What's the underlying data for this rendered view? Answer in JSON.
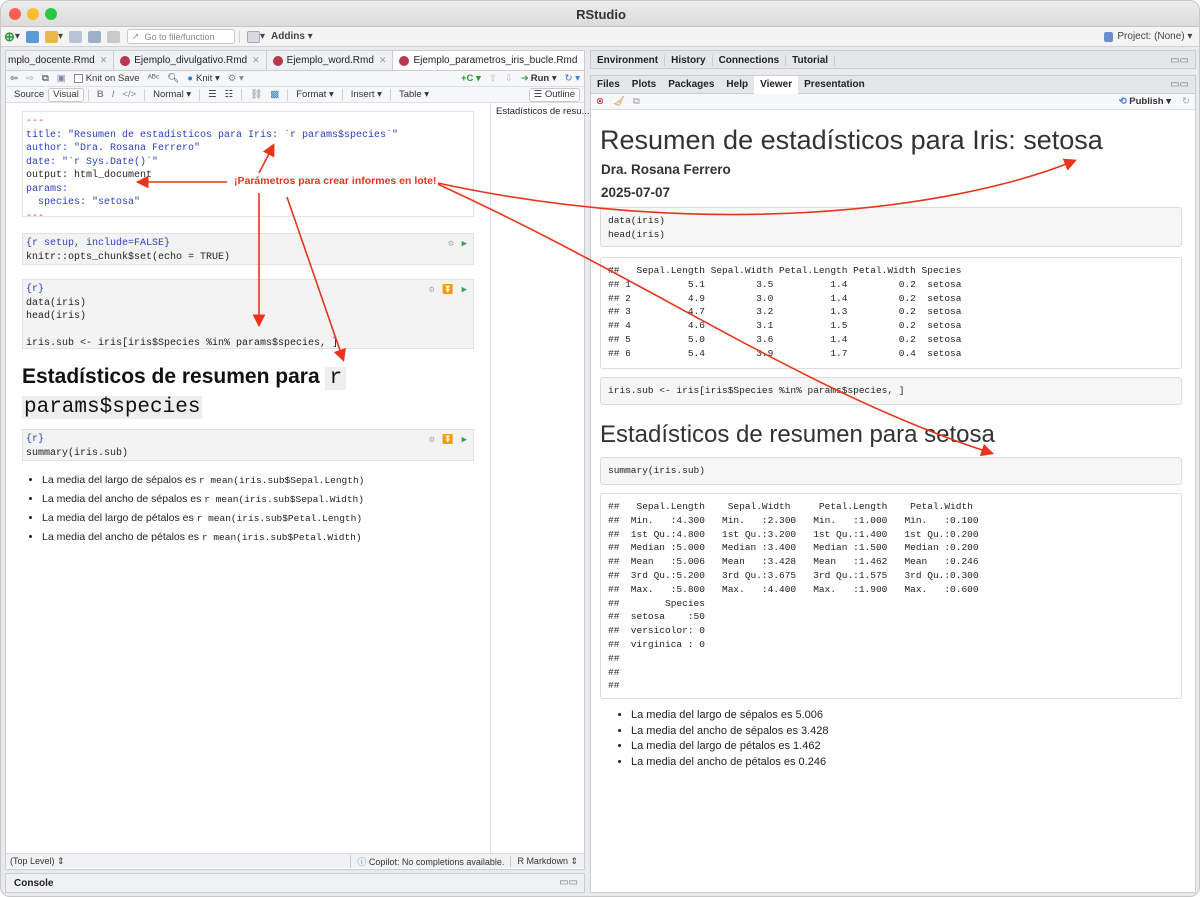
{
  "window": {
    "title": "RStudio"
  },
  "toolbar": {
    "goto_placeholder": "Go to file/function",
    "addins": "Addins",
    "project": "Project: (None)"
  },
  "editor": {
    "tabs": [
      "mplo_docente.Rmd",
      "Ejemplo_divulgativo.Rmd",
      "Ejemplo_word.Rmd",
      "Ejemplo_parametros_iris_bucle.Rmd"
    ],
    "toolbar": {
      "knit_on_save": "Knit on Save",
      "knit": "Knit",
      "run": "Run",
      "source": "Source",
      "visual": "Visual",
      "normal": "Normal",
      "format": "Format",
      "insert": "Insert",
      "table": "Table",
      "outline": "Outline"
    },
    "outline_item": "Estadísticos de resu...",
    "yaml": [
      "---",
      "title: \"Resumen de estadísticos para Iris: `r params$species`\"",
      "author: \"Dra. Rosana Ferrero\"",
      "date: \"`r Sys.Date()`\"",
      "output: html_document",
      "params:",
      "  species: \"setosa\"",
      "---"
    ],
    "chunk_setup": [
      "{r setup, include=FALSE}",
      "knitr::opts_chunk$set(echo = TRUE)"
    ],
    "chunk_data": [
      "{r}",
      "data(iris)",
      "head(iris)",
      "",
      "iris.sub <- iris[iris$Species %in% params$species, ]"
    ],
    "heading_text": "Estadísticos de resumen para",
    "heading_code1": "r",
    "heading_code2": "params$species",
    "chunk_summary": [
      "{r}",
      "summary(iris.sub)"
    ],
    "bullets": [
      {
        "text": "La media del largo de sépalos es",
        "code": "r mean(iris.sub$Sepal.Length)"
      },
      {
        "text": "La media del ancho de sépalos es",
        "code": "r mean(iris.sub$Sepal.Width)"
      },
      {
        "text": "La media del largo de pétalos es",
        "code": "r mean(iris.sub$Petal.Length)"
      },
      {
        "text": "La media del ancho de pétalos es",
        "code": "r mean(iris.sub$Petal.Width)"
      }
    ],
    "status_scope": "(Top Level)",
    "copilot": "Copilot: No completions available.",
    "mode": "R Markdown"
  },
  "annotation": "¡Parámetros para crear informes en lote!",
  "console": {
    "label": "Console"
  },
  "right_top": {
    "tabs": [
      "Environment",
      "History",
      "Connections",
      "Tutorial"
    ]
  },
  "viewer_pane": {
    "tabs": [
      "Files",
      "Plots",
      "Packages",
      "Help",
      "Viewer",
      "Presentation"
    ],
    "publish": "Publish"
  },
  "report": {
    "title": "Resumen de estadísticos para Iris: setosa",
    "author": "Dra. Rosana Ferrero",
    "date": "2025-07-07",
    "code1": "data(iris)\nhead(iris)",
    "out1": "##   Sepal.Length Sepal.Width Petal.Length Petal.Width Species\n## 1          5.1         3.5          1.4         0.2  setosa\n## 2          4.9         3.0          1.4         0.2  setosa\n## 3          4.7         3.2          1.3         0.2  setosa\n## 4          4.6         3.1          1.5         0.2  setosa\n## 5          5.0         3.6          1.4         0.2  setosa\n## 6          5.4         3.9          1.7         0.4  setosa",
    "code2": "iris.sub <- iris[iris$Species %in% params$species, ]",
    "heading": "Estadísticos de resumen para setosa",
    "code3": "summary(iris.sub)",
    "out2": "##   Sepal.Length    Sepal.Width     Petal.Length    Petal.Width   \n##  Min.   :4.300   Min.   :2.300   Min.   :1.000   Min.   :0.100  \n##  1st Qu.:4.800   1st Qu.:3.200   1st Qu.:1.400   1st Qu.:0.200  \n##  Median :5.000   Median :3.400   Median :1.500   Median :0.200  \n##  Mean   :5.006   Mean   :3.428   Mean   :1.462   Mean   :0.246  \n##  3rd Qu.:5.200   3rd Qu.:3.675   3rd Qu.:1.575   3rd Qu.:0.300  \n##  Max.   :5.800   Max.   :4.400   Max.   :1.900   Max.   :0.600  \n##        Species  \n##  setosa    :50  \n##  versicolor: 0  \n##  virginica : 0  \n##                 \n##                 \n##                 ",
    "bullets": [
      "La media del largo de sépalos es 5.006",
      "La media del ancho de sépalos es 3.428",
      "La media del largo de pétalos es 1.462",
      "La media del ancho de pétalos es 0.246"
    ]
  },
  "colors": {
    "accent_arrow": "#e8341c",
    "yaml_blue": "#2a3fbf",
    "rmd_icon": "#b7394f"
  }
}
